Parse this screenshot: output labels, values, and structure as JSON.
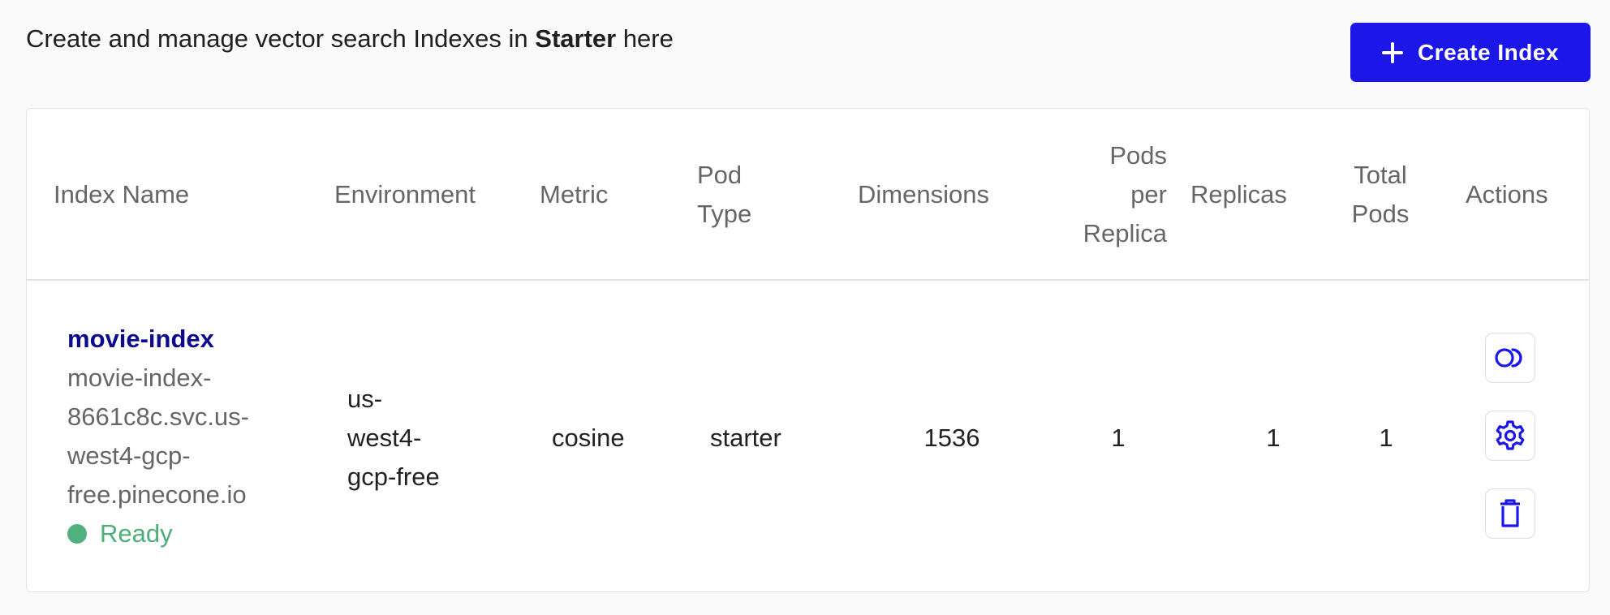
{
  "intro": {
    "prefix": "Create and manage vector search Indexes in ",
    "project": "Starter",
    "suffix": " here"
  },
  "create_button": {
    "label": "Create Index",
    "icon": "plus-icon"
  },
  "table": {
    "columns": {
      "index_name": "Index Name",
      "environment": "Environment",
      "metric": "Metric",
      "pod_type": [
        "Pod",
        "Type"
      ],
      "dimensions": "Dimensions",
      "pods_per_replica": [
        "Pods",
        "per",
        "Replica"
      ],
      "replicas": "Replicas",
      "total_pods": [
        "Total",
        "Pods"
      ],
      "actions": "Actions"
    },
    "rows": [
      {
        "name": "movie-index",
        "host": [
          "movie-index-",
          "8661c8c.svc.us-",
          "west4-gcp-",
          "free.pinecone.io"
        ],
        "status": "Ready",
        "environment": [
          "us-",
          "west4-",
          "gcp-free"
        ],
        "metric": "cosine",
        "pod_type": "starter",
        "dimensions": "1536",
        "pods_per_replica": "1",
        "replicas": "1",
        "total_pods": "1",
        "actions": [
          "collection-icon",
          "gear-icon",
          "trash-icon"
        ]
      }
    ]
  },
  "colors": {
    "accent": "#1c17e8",
    "link": "#0e0a8c",
    "ready": "#52b07f"
  }
}
